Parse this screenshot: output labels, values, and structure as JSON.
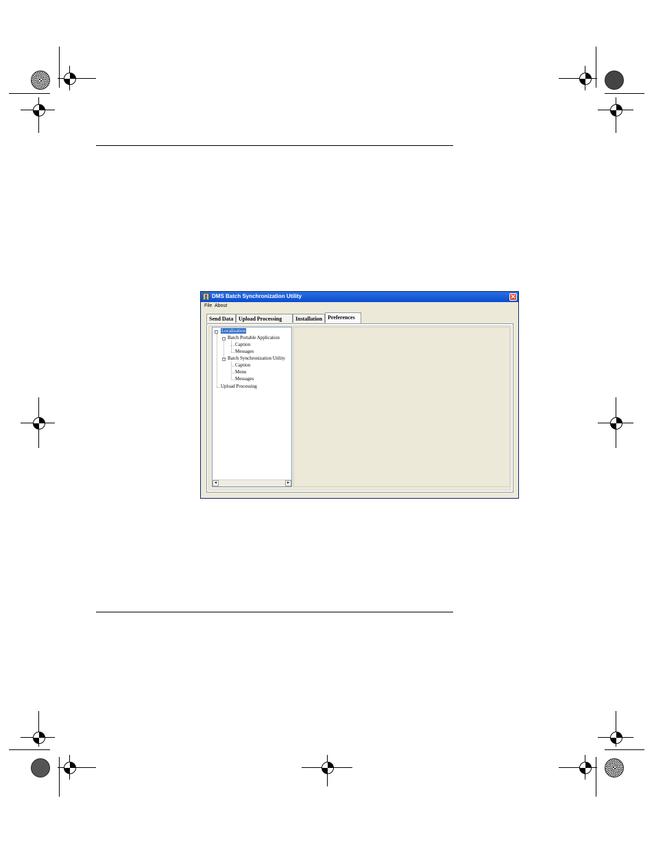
{
  "window": {
    "title": "DMS Batch Synchronization Utility",
    "close_glyph": "✕",
    "app_icon": "app-icon"
  },
  "menu": {
    "file": "File",
    "about": "About"
  },
  "tabs": [
    {
      "label": "Send Data",
      "active": false
    },
    {
      "label": "Upload Processing",
      "active": false
    },
    {
      "label": "Installation",
      "active": false
    },
    {
      "label": "Preferences",
      "active": true
    }
  ],
  "tree": {
    "root": "Localization",
    "items": [
      {
        "label": "Batch Portable Application"
      },
      {
        "label": "Caption"
      },
      {
        "label": "Messages"
      },
      {
        "label": "Batch Synchronization Utility"
      },
      {
        "label": "Caption"
      },
      {
        "label": "Menu"
      },
      {
        "label": "Messages"
      },
      {
        "label": "Upload Processing"
      }
    ],
    "expander_collapse": "−",
    "scroll_left": "◂",
    "scroll_right": "▸"
  },
  "colors": {
    "titlebar": "#0a4bd0",
    "close": "#d9512c",
    "selection": "#316ac5",
    "panel_bg": "#ece9d8"
  }
}
